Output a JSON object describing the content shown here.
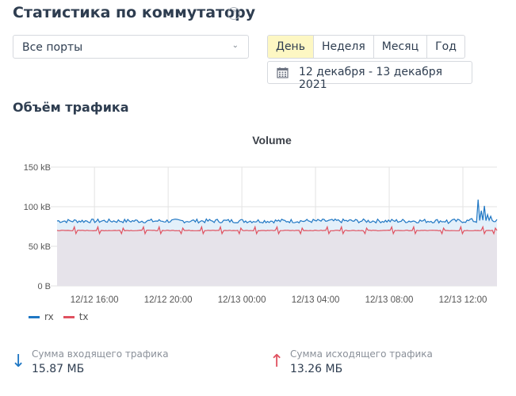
{
  "header": {
    "title": "Статистика по коммутатору",
    "help_icon": "question-circle-icon",
    "help_glyph": "?"
  },
  "port_select": {
    "value": "Все порты",
    "chevron": "⌄"
  },
  "periods": [
    {
      "label": "День",
      "active": true
    },
    {
      "label": "Неделя",
      "active": false
    },
    {
      "label": "Месяц",
      "active": false
    },
    {
      "label": "Год",
      "active": false
    }
  ],
  "date_range": {
    "icon": "calendar-icon",
    "text": "12 декабря - 13 декабря 2021"
  },
  "section_title": "Объём трафика",
  "legend": [
    {
      "name": "rx",
      "color": "#1f77c4"
    },
    {
      "name": "tx",
      "color": "#e05260"
    }
  ],
  "totals": {
    "incoming": {
      "label": "Сумма входящего трафика",
      "value": "15.87 МБ",
      "arrow": "↓",
      "color": "#1f77c4"
    },
    "outgoing": {
      "label": "Сумма исходящего трафика",
      "value": "13.26 МБ",
      "arrow": "↑",
      "color": "#e05260"
    }
  },
  "chart_data": {
    "type": "area",
    "title": "Volume",
    "xlabel": "",
    "ylabel": "",
    "x_range_hours": [
      -2.03,
      21.85
    ],
    "x_ticks": [
      {
        "hour": 0,
        "label": "12/12 16:00"
      },
      {
        "hour": 4,
        "label": "12/12 20:00"
      },
      {
        "hour": 8,
        "label": "12/13 00:00"
      },
      {
        "hour": 12,
        "label": "12/13 04:00"
      },
      {
        "hour": 16,
        "label": "12/13 08:00"
      },
      {
        "hour": 20,
        "label": "12/13 12:00"
      }
    ],
    "ylim": [
      0,
      150
    ],
    "y_unit": "kB",
    "y_ticks": [
      {
        "value": 0,
        "label": "0 B"
      },
      {
        "value": 50,
        "label": "50 kB"
      },
      {
        "value": 100,
        "label": "100 kB"
      },
      {
        "value": 150,
        "label": "150 kB"
      }
    ],
    "grid": true,
    "legend_position": "bottom-left",
    "series": [
      {
        "name": "rx",
        "color": "#1f77c4",
        "fill": "#e3f0fa",
        "baseline": 82,
        "noise": 2.5,
        "events": [
          {
            "hour": 19.2,
            "value": 79
          },
          {
            "hour": 20.5,
            "value": 85
          },
          {
            "hour": 20.85,
            "value": 109
          },
          {
            "hour": 21.0,
            "value": 95
          },
          {
            "hour": 21.15,
            "value": 101
          },
          {
            "hour": 21.35,
            "value": 90
          },
          {
            "hour": 21.55,
            "value": 88
          },
          {
            "hour": 21.85,
            "value": 84
          }
        ]
      },
      {
        "name": "tx",
        "color": "#e05260",
        "fill": "#e6e3ea",
        "baseline": 70,
        "noise": 0.4,
        "spikes_hours": [
          -1.1,
          0.2,
          1.5,
          2.7,
          3.5,
          4.7,
          5.8,
          6.8,
          7.9,
          8.7,
          9.9,
          11.2,
          12.6,
          13.4,
          14.7,
          16.1,
          17.3,
          18.9,
          19.9,
          21.1,
          21.7
        ]
      }
    ]
  }
}
